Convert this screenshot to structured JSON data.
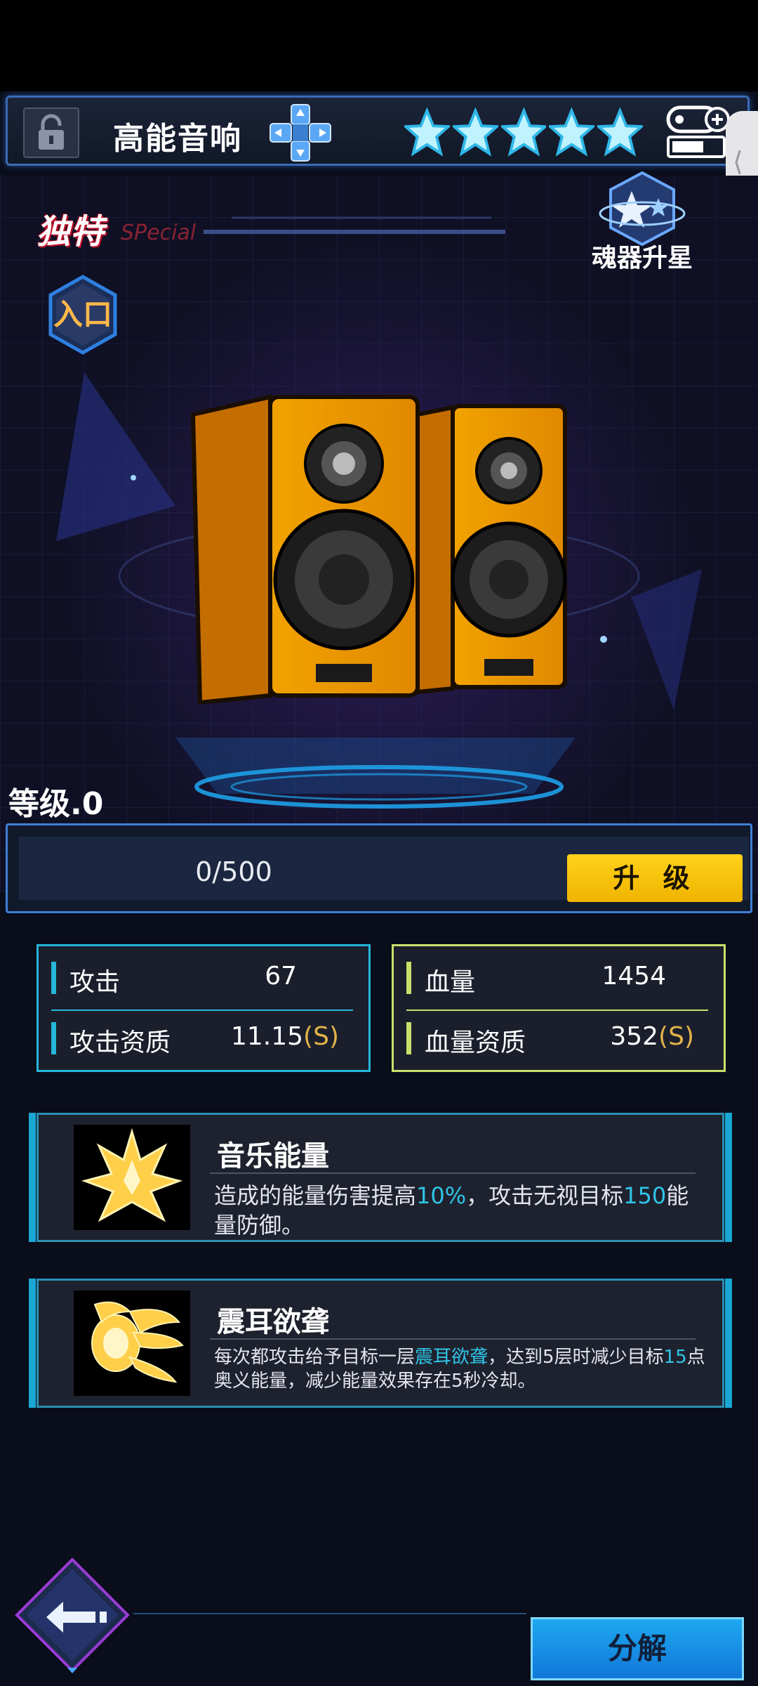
{
  "header": {
    "title": "高能音响",
    "stars_filled": 5,
    "stars_total": 5,
    "lock_icon": "lock-icon",
    "dpad_icon": "dpad-icon",
    "equip_icon": "gamepad-battery-icon"
  },
  "item": {
    "rarity": "独特",
    "rarity_en": "SPecial",
    "tag_label": "入口",
    "upgrade_star_label": "魂器升星",
    "image": "speakers"
  },
  "level": {
    "label": "等级.0",
    "exp_text": "0/500",
    "exp_progress": 0,
    "upgrade_button": "升 级"
  },
  "stats": {
    "attack": {
      "label": "攻击",
      "value": "67"
    },
    "attack_quality": {
      "label": "攻击资质",
      "value": "11.15",
      "grade": "(S)"
    },
    "hp": {
      "label": "血量",
      "value": "1454"
    },
    "hp_quality": {
      "label": "血量资质",
      "value": "352",
      "grade": "(S)"
    }
  },
  "skills": [
    {
      "name": "音乐能量",
      "desc_parts": [
        "造成的能量伤害提高",
        "10%",
        "，攻击无视目标",
        "150",
        "能量防御。"
      ]
    },
    {
      "name": "震耳欲聋",
      "desc_parts": [
        "每次都攻击给予目标一层",
        "震耳欲聋",
        "，达到5层时减少目标",
        "15",
        "点奥义能量，减少能量效果存在5秒冷却。"
      ]
    }
  ],
  "footer": {
    "back_icon": "back-arrow-icon",
    "decompose_button": "分解"
  },
  "colors": {
    "accent_blue": "#3f7fd6",
    "upgrade_yellow": "#ffd21a",
    "attack_cyan": "#25b6d8",
    "hp_green": "#c9e06a",
    "highlight": "#2fc4e6"
  }
}
